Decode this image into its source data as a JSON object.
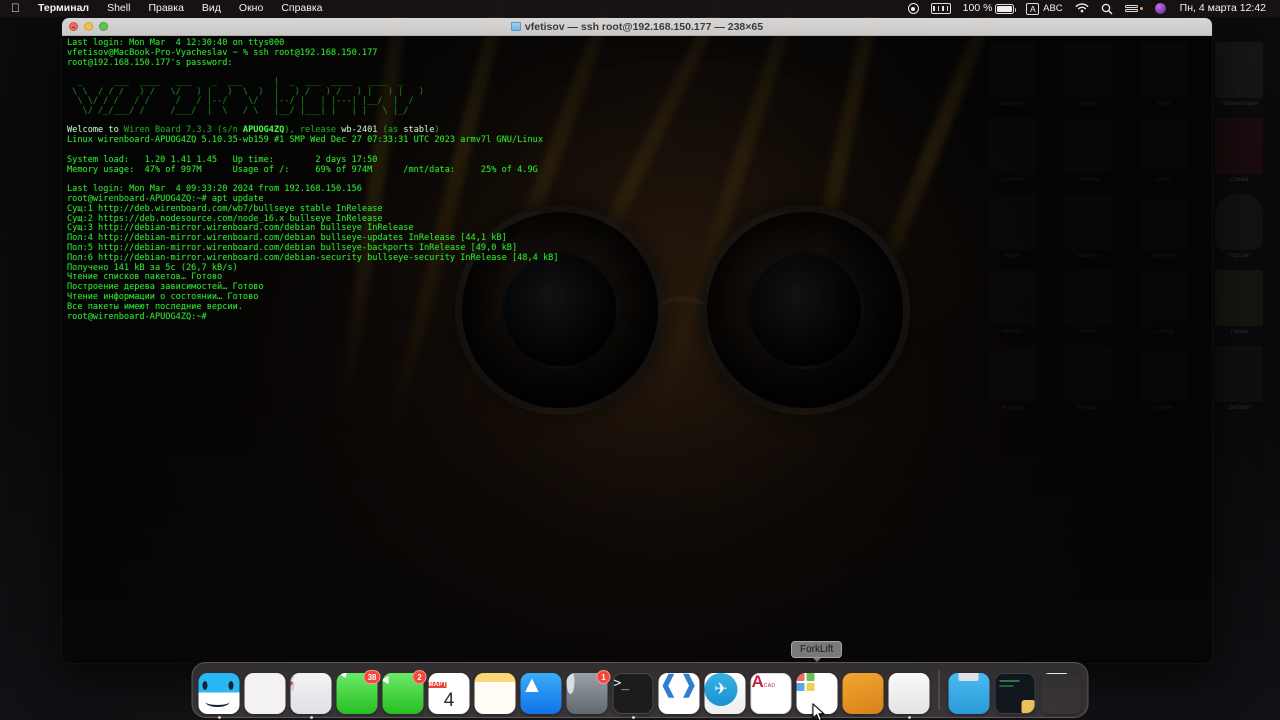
{
  "menubar": {
    "apple_icon": "apple-icon",
    "items": [
      "Терминал",
      "Shell",
      "Правка",
      "Вид",
      "Окно",
      "Справка"
    ],
    "status": {
      "record_icon": "record-icon",
      "keyboard_icon": "keyboard-icon",
      "battery_percent": "100 %",
      "battery_icon": "battery-icon",
      "input_source_key": "A",
      "input_source": "ABC",
      "wifi_icon": "wifi-icon",
      "search_icon": "search-icon",
      "control_center_icon": "control-center-icon",
      "siri_icon": "siri-icon",
      "datetime": "Пн, 4 марта 12:42"
    }
  },
  "window": {
    "title": "vfetisov — ssh root@192.168.150.177 — 238×65",
    "close_label": "Закрыть",
    "minimize_label": "Свернуть",
    "zoom_label": "Развернуть"
  },
  "terminal": {
    "lines": [
      "Last login: Mon Mar  4 12:30:40 on ttys000",
      "vfetisov@MacBook-Pro-Vyacheslav ~ % ssh root@192.168.150.177",
      "root@192.168.150.177's password:"
    ],
    "ascii_logo": [
      "  _      ___  ____   ___    _  ___      |  _  ___  ____   ____  _     ",
      " \\ \\  / / /   ) /   \\/   ) |   )  \\  )  |   ) /   ) /   ) |   ) |   ) ",
      "  \\ \\/ / /   / /     /   / |--/    \\/   |--/ |   | |---| |__/  |  /  ",
      "   \\/ /_/___/ /     /___/  |  \\   / \\   |__/ |___| |   | |   \\ |_/   "
    ],
    "welcome": [
      {
        "text": "Welcome to ",
        "cls": "wht"
      },
      {
        "text": "Wiren Board 7.3.3 (s/n ",
        "cls": "dim"
      },
      {
        "text": "APUOG4ZQ",
        "cls": "bold"
      },
      {
        "text": "), release ",
        "cls": "dim"
      },
      {
        "text": "wb-2401",
        "cls": "wht"
      },
      {
        "text": " (as ",
        "cls": "dim"
      },
      {
        "text": "stable",
        "cls": "wht"
      },
      {
        "text": ")",
        "cls": "dim"
      }
    ],
    "uname": "Linux wirenboard-APUOG4ZQ 5.10.35-wb159 #1 SMP Wed Dec 27 07:33:31 UTC 2023 armv7l GNU/Linux",
    "stats": [
      "System load:   1.20 1.41 1.45   Up time:        2 days 17:50",
      "Memory usage:  47% of 997M      Usage of /:     69% of 974M      /mnt/data:     25% of 4.9G"
    ],
    "session": [
      "Last login: Mon Mar  4 09:33:20 2024 from 192.168.150.156",
      "root@wirenboard-APUOG4ZQ:~# apt update",
      "Сущ:1 http://deb.wirenboard.com/wb7/bullseye stable InRelease",
      "Сущ:2 https://deb.nodesource.com/node_16.x bullseye InRelease",
      "Сущ:3 http://debian-mirror.wirenboard.com/debian bullseye InRelease",
      "Пол:4 http://debian-mirror.wirenboard.com/debian bullseye-updates InRelease [44,1 kB]",
      "Пол:5 http://debian-mirror.wirenboard.com/debian bullseye-backports InRelease [49,0 kB]",
      "Пол:6 http://debian-mirror.wirenboard.com/debian-security bullseye-security InRelease [48,4 kB]",
      "Получено 141 kB за 5с (26,7 kB/s)",
      "Чтение списков пакетов… Готово",
      "Построение дерева зависимостей… Готово",
      "Чтение информации о состоянии… Готово",
      "Все пакеты имеют последние версии.",
      "root@wirenboard-APUOG4ZQ:~#"
    ],
    "colors": {
      "foreground": "#2fe02f",
      "background": "rgba(0,0,0,0.58)",
      "ascii": "#187a18"
    }
  },
  "tooltip": {
    "text": "ForkLift"
  },
  "dock": {
    "items": [
      {
        "name": "finder",
        "label": "Finder",
        "badge": null,
        "running": true
      },
      {
        "name": "launchpad",
        "label": "Launchpad",
        "badge": null,
        "running": false
      },
      {
        "name": "safari",
        "label": "Safari",
        "badge": null,
        "running": true
      },
      {
        "name": "messages",
        "label": "Сообщения",
        "badge": "38",
        "running": false
      },
      {
        "name": "facetime",
        "label": "FaceTime",
        "badge": "2",
        "running": false
      },
      {
        "name": "calendar",
        "label": "Календарь",
        "badge": null,
        "running": false,
        "month": "МАРТ",
        "day": "4"
      },
      {
        "name": "notes",
        "label": "Заметки",
        "badge": null,
        "running": false
      },
      {
        "name": "app-store",
        "label": "App Store",
        "badge": null,
        "running": false
      },
      {
        "name": "system-settings",
        "label": "Системные настройки",
        "badge": "1",
        "running": false
      },
      {
        "name": "terminal",
        "label": "Терминал",
        "badge": null,
        "running": true
      },
      {
        "name": "vs-code",
        "label": "Visual Studio Code",
        "badge": null,
        "running": false
      },
      {
        "name": "telegram",
        "label": "Telegram",
        "badge": null,
        "running": false
      },
      {
        "name": "a-cad",
        "label": "A-CAD",
        "badge": null,
        "running": false
      },
      {
        "name": "app-installer",
        "label": "Установщик",
        "badge": null,
        "running": false
      },
      {
        "name": "forklift",
        "label": "ForkLift",
        "badge": null,
        "running": false
      },
      {
        "name": "quicklook",
        "label": "QuickLook",
        "badge": null,
        "running": true
      }
    ],
    "right_items": [
      {
        "name": "downloads-folder",
        "label": "Загрузки"
      },
      {
        "name": "minimized-window",
        "label": "Свернутое окно"
      },
      {
        "name": "trash",
        "label": "Корзина"
      }
    ]
  },
  "desktop": {
    "icons": [
      {
        "label": "Документ",
        "kind": "file"
      },
      {
        "label": "Проект",
        "kind": "file"
      },
      {
        "label": "Файл",
        "kind": "file"
      },
      {
        "label": "Презентация",
        "kind": "doc"
      },
      {
        "label": "Снимок",
        "kind": "file"
      },
      {
        "label": "Таблица",
        "kind": "file"
      },
      {
        "label": "Отчет",
        "kind": "file"
      },
      {
        "label": "Схема",
        "kind": "red"
      },
      {
        "label": "Архив",
        "kind": "file"
      },
      {
        "label": "Заметка",
        "kind": "file"
      },
      {
        "label": "Данные",
        "kind": "file"
      },
      {
        "label": "Портрет",
        "kind": "person"
      },
      {
        "label": "Резерв",
        "kind": "file"
      },
      {
        "label": "Копия",
        "kind": "file"
      },
      {
        "label": "Список",
        "kind": "file"
      },
      {
        "label": "Папка",
        "kind": "yellow"
      },
      {
        "label": "Журнал",
        "kind": "file"
      },
      {
        "label": "Конфиг",
        "kind": "file"
      },
      {
        "label": "Скрипт",
        "kind": "file"
      },
      {
        "label": "Экспорт",
        "kind": "file"
      }
    ]
  }
}
